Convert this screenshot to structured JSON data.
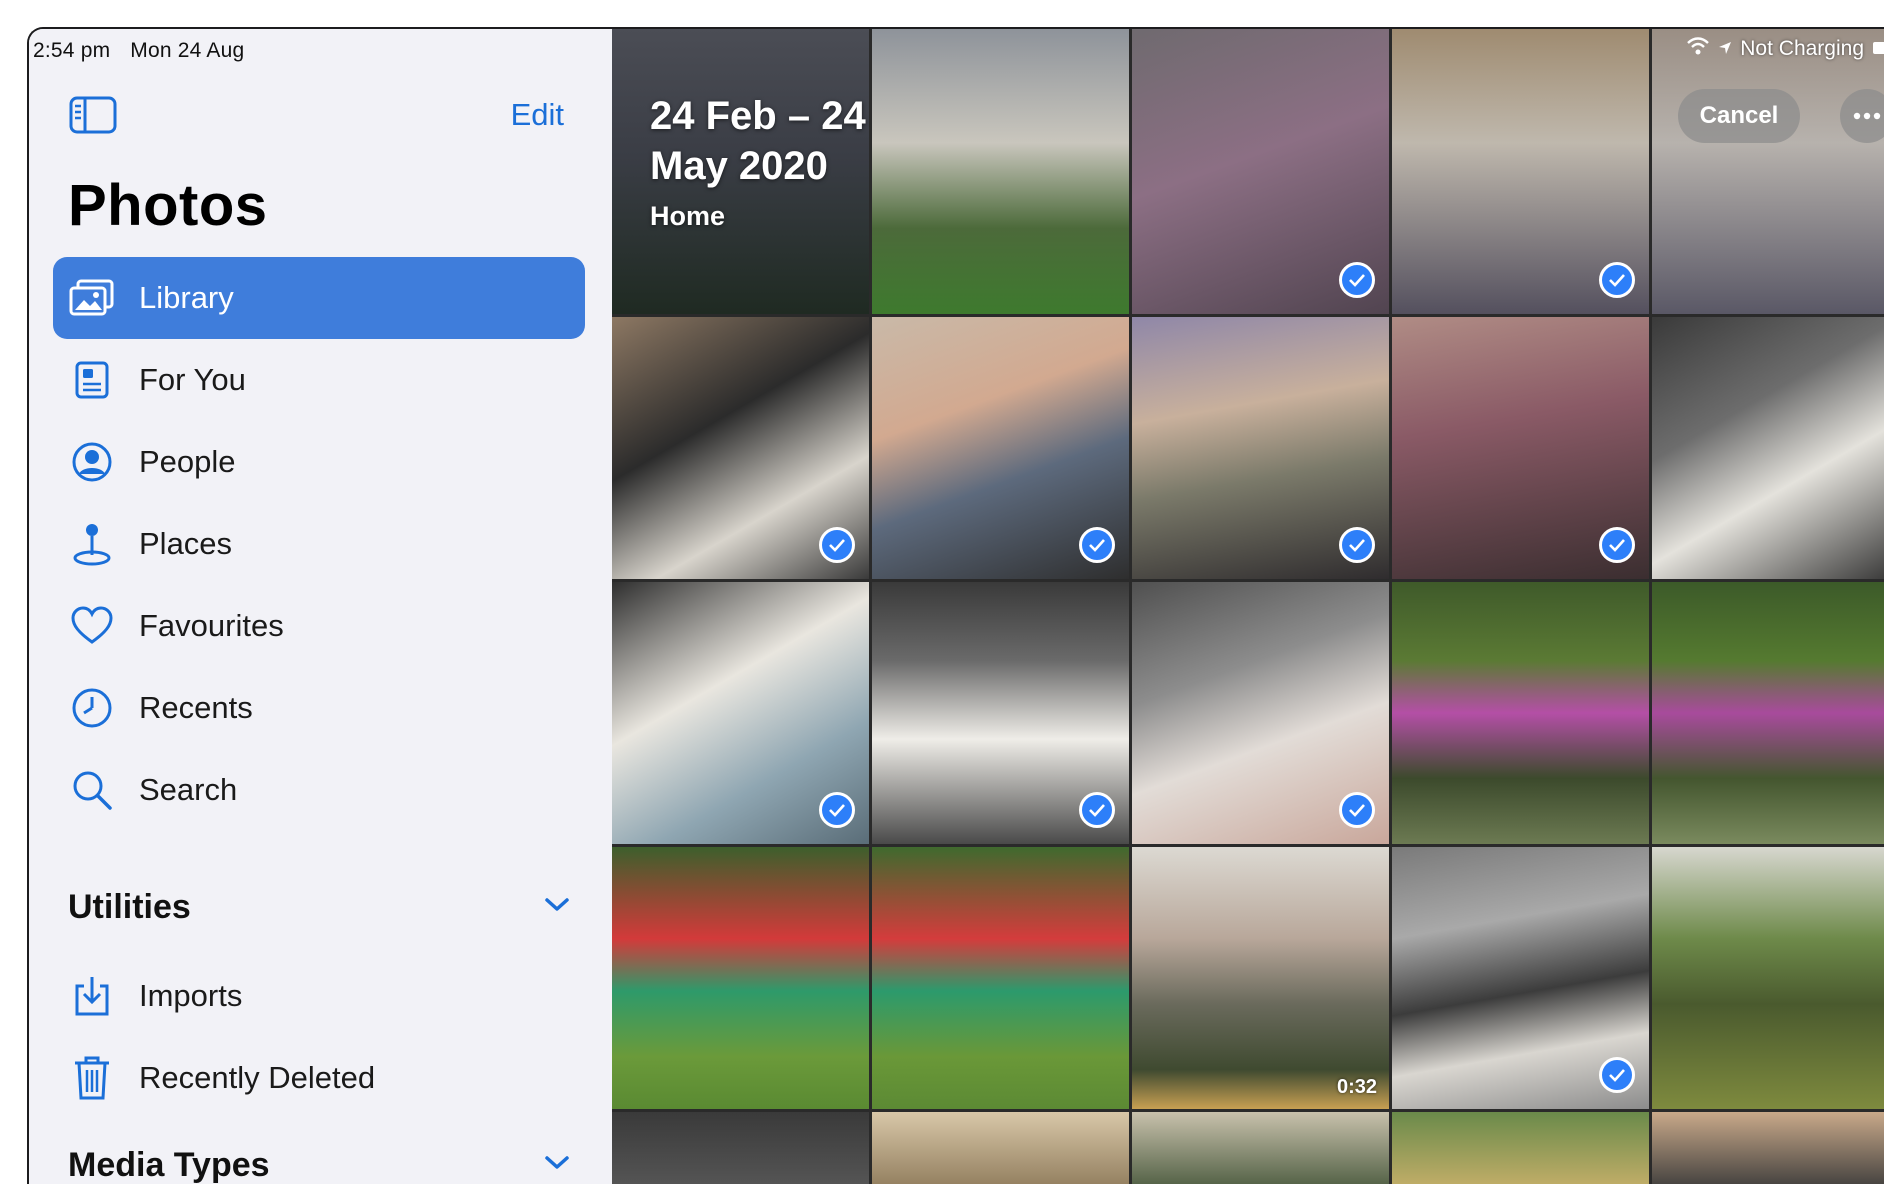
{
  "status_bar": {
    "time": "2:54 pm",
    "date": "Mon 24 Aug",
    "battery_text": "Not Charging"
  },
  "sidebar": {
    "edit_label": "Edit",
    "title": "Photos",
    "items": [
      {
        "label": "Library",
        "icon": "library-icon",
        "active": true
      },
      {
        "label": "For You",
        "icon": "for-you-icon"
      },
      {
        "label": "People",
        "icon": "people-icon"
      },
      {
        "label": "Places",
        "icon": "places-pin-icon"
      },
      {
        "label": "Favourites",
        "icon": "heart-icon"
      },
      {
        "label": "Recents",
        "icon": "clock-icon"
      },
      {
        "label": "Search",
        "icon": "search-icon"
      }
    ],
    "utilities": {
      "label": "Utilities",
      "items": [
        {
          "label": "Imports",
          "icon": "import-icon"
        },
        {
          "label": "Recently Deleted",
          "icon": "trash-icon"
        }
      ]
    },
    "media_types": {
      "label": "Media Types"
    }
  },
  "grid": {
    "date_range": "24 Feb – 24 May 2020",
    "date_line1": "24 Feb – 24",
    "date_line2": "May 2020",
    "location": "Home",
    "cancel_label": "Cancel",
    "video_duration": "0:32"
  },
  "colors": {
    "accent": "#3f7ddb",
    "link": "#1b6fd8",
    "selection_badge": "#2d7ff9"
  }
}
